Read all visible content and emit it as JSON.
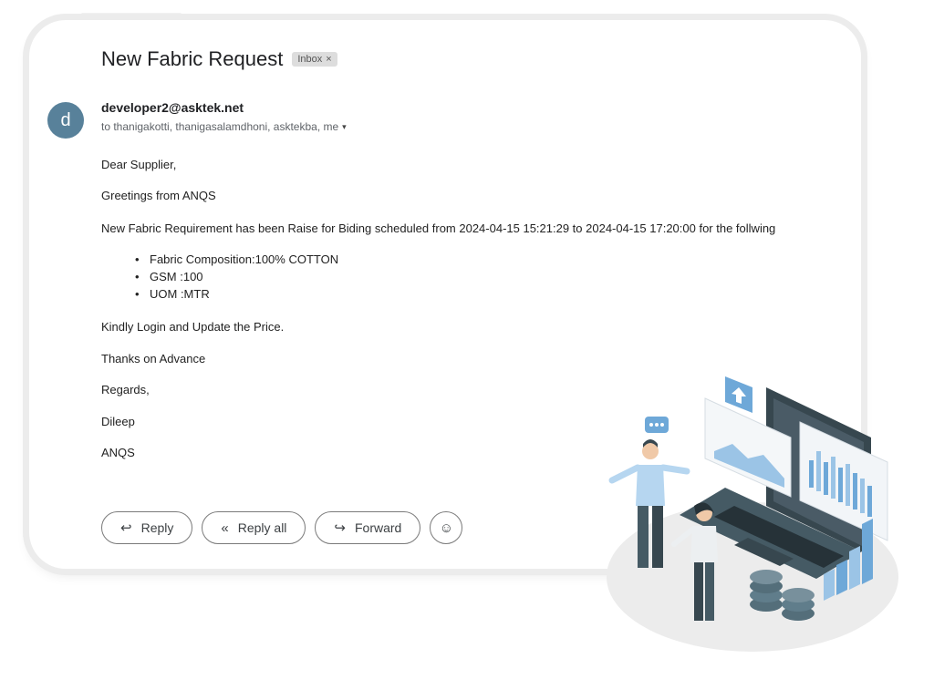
{
  "email": {
    "subject": "New Fabric Request",
    "label": "Inbox",
    "label_close": "×",
    "avatar_letter": "d",
    "sender": "developer2@asktek.net",
    "recipients": "to thanigakotti, thanigasalamdhoni, asktekba, me",
    "recipients_caret": "▾",
    "body": {
      "greeting": "Dear Supplier,",
      "intro": "Greetings from ANQS",
      "requirement": "New Fabric Requirement has been Raise for Biding scheduled from 2024-04-15 15:21:29 to 2024-04-15 17:20:00 for the follwing",
      "bullets": [
        "Fabric Composition:100% COTTON",
        "GSM :100",
        "UOM :MTR"
      ],
      "instruction": "Kindly Login and Update the Price.",
      "thanks": "Thanks on Advance",
      "regards": "Regards,",
      "name": "Dileep",
      "company": "ANQS"
    }
  },
  "actions": {
    "reply": "Reply",
    "reply_all": "Reply all",
    "forward": "Forward",
    "reply_icon": "↩",
    "reply_all_icon": "«",
    "forward_icon": "↪",
    "emoji_icon": "☺"
  },
  "colors": {
    "avatar_bg": "#58819a",
    "illustration_accent": "#6ea8d8",
    "illustration_dark": "#37474f"
  }
}
